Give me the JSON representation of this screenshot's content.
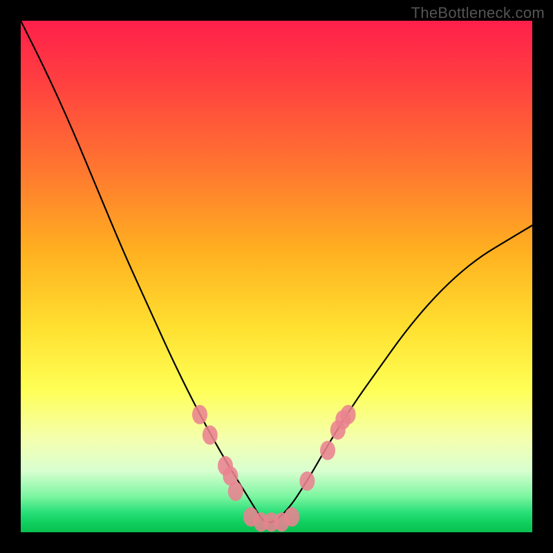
{
  "watermark": "TheBottleneck.com",
  "chart_data": {
    "type": "line",
    "title": "",
    "xlabel": "",
    "ylabel": "",
    "xlim": [
      0,
      100
    ],
    "ylim": [
      0,
      100
    ],
    "note": "V-shaped mismatch curve on red→green vertical gradient; minimum (green) around x≈48. Rose markers cluster near the valley and on the ascending right arm.",
    "series": [
      {
        "name": "curve",
        "x": [
          0,
          5,
          10,
          15,
          20,
          25,
          30,
          35,
          40,
          45,
          48,
          52,
          56,
          60,
          65,
          70,
          75,
          80,
          85,
          90,
          95,
          100
        ],
        "y": [
          100,
          90,
          79,
          67,
          55,
          44,
          33,
          23,
          14,
          6,
          1,
          4,
          10,
          17,
          25,
          32,
          39,
          45,
          50,
          54,
          57,
          60
        ]
      }
    ],
    "markers": [
      {
        "x": 35,
        "y": 23
      },
      {
        "x": 37,
        "y": 19
      },
      {
        "x": 40,
        "y": 13
      },
      {
        "x": 41,
        "y": 11
      },
      {
        "x": 42,
        "y": 8
      },
      {
        "x": 45,
        "y": 3
      },
      {
        "x": 47,
        "y": 2
      },
      {
        "x": 49,
        "y": 2
      },
      {
        "x": 51,
        "y": 2
      },
      {
        "x": 53,
        "y": 3
      },
      {
        "x": 56,
        "y": 10
      },
      {
        "x": 60,
        "y": 16
      },
      {
        "x": 62,
        "y": 20
      },
      {
        "x": 63,
        "y": 22
      },
      {
        "x": 64,
        "y": 23
      }
    ],
    "gradient_stops": [
      {
        "pos": 0,
        "color": "#ff1f4b"
      },
      {
        "pos": 60,
        "color": "#ffe030"
      },
      {
        "pos": 100,
        "color": "#08c050"
      }
    ]
  }
}
